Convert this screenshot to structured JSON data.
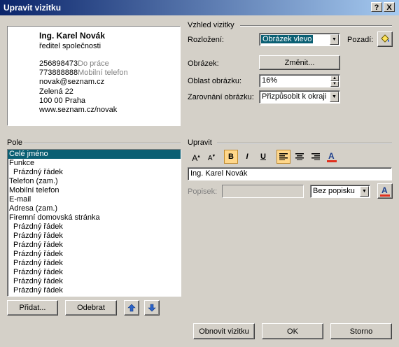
{
  "window": {
    "title": "Upravit vizitku"
  },
  "titlebar": {
    "help": "?",
    "close": "X"
  },
  "card": {
    "name": "Ing. Karel Novák",
    "position": "ředitel společnosti",
    "phone1": "256898473",
    "phone1_label": "Do práce",
    "phone2": "773888888",
    "phone2_label": "Mobilní telefon",
    "email": "novak@seznam.cz",
    "street": "Zelená 22",
    "city": "100 00  Praha",
    "web": "www.seznam.cz/novak"
  },
  "appearance": {
    "header": "Vzhled vizitky",
    "layout_label": "Rozložení:",
    "layout_value": "Obrázek vlevo",
    "background_label": "Pozadí:",
    "image_label": "Obrázek:",
    "change_button": "Změnit...",
    "image_area_label": "Oblast obrázku:",
    "image_area_value": "16%",
    "image_align_label": "Zarovnání obrázku:",
    "image_align_value": "Přizpůsobit k okraji"
  },
  "fields": {
    "header": "Pole",
    "items": [
      "Celé jméno",
      "Funkce",
      "Prázdný řádek",
      "Telefon (zam.)",
      "Mobilní telefon",
      "E-mail",
      "Adresa (zam.)",
      "Firemní domovská stránka",
      "Prázdný řádek",
      "Prázdný řádek",
      "Prázdný řádek",
      "Prázdný řádek",
      "Prázdný řádek",
      "Prázdný řádek",
      "Prázdný řádek",
      "Prázdný řádek"
    ],
    "add_button": "Přidat...",
    "remove_button": "Odebrat"
  },
  "edit": {
    "header": "Upravit",
    "text_value": "Ing. Karel Novák",
    "caption_label": "Popisek:",
    "caption_dropdown": "Bez popisku"
  },
  "footer": {
    "reset_button": "Obnovit vizitku",
    "ok_button": "OK",
    "cancel_button": "Storno"
  },
  "colors": {
    "selection": "#0a5f73",
    "title_bar": "#0a246a",
    "active_format": "#ffd78a"
  }
}
